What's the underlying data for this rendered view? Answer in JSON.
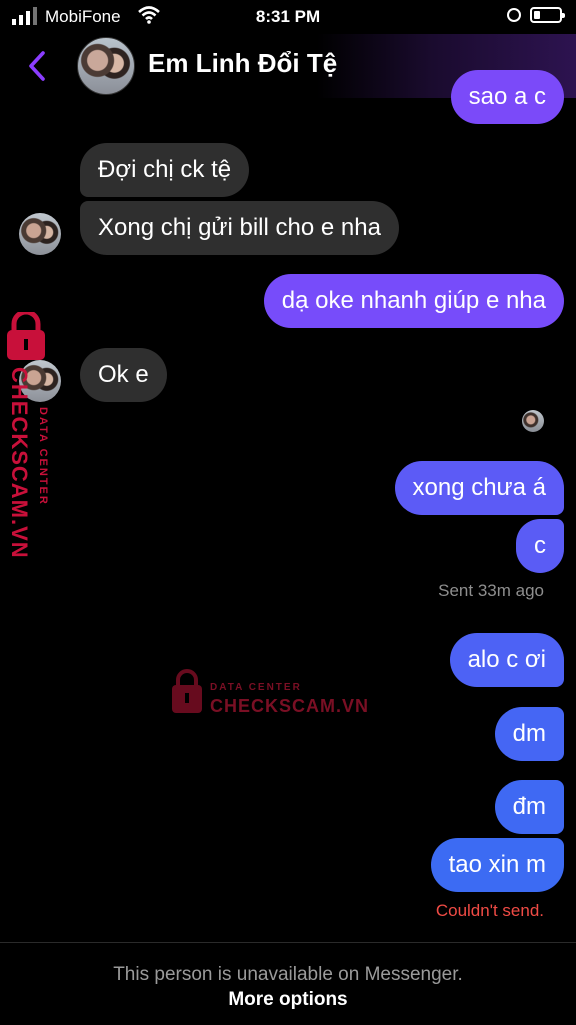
{
  "status_bar": {
    "carrier": "MobiFone",
    "time": "8:31 PM"
  },
  "header": {
    "contact_name": "Em Linh Đổi Tệ",
    "accent_color": "#8b3dff"
  },
  "messages": {
    "top_partial": "sao a c",
    "m1": "Đợi chị ck tệ",
    "m2": "Xong chị gửi bill cho e nha",
    "m3": "dạ oke nhanh giúp e nha",
    "m4": "Ok e",
    "m5": "xong chưa á",
    "m6": "c",
    "sent_status": "Sent 33m ago",
    "m7": "alo c ơi",
    "m8": "dm",
    "m9": "đm",
    "m10": "tao xin m",
    "error_status": "Couldn't send."
  },
  "watermark": {
    "brand": "CHECKSCAM.VN",
    "subtitle": "DATA CENTER"
  },
  "footer": {
    "unavailable_text": "This person is unavailable on Messenger.",
    "more_options": "More options"
  },
  "colors": {
    "incoming_bubble": "#2f2f2f",
    "outgoing_top": "#7a4dfa",
    "outgoing_bottom": "#3d6bf3",
    "error_text": "#f04b45",
    "meta_text": "#8e8e8e"
  }
}
